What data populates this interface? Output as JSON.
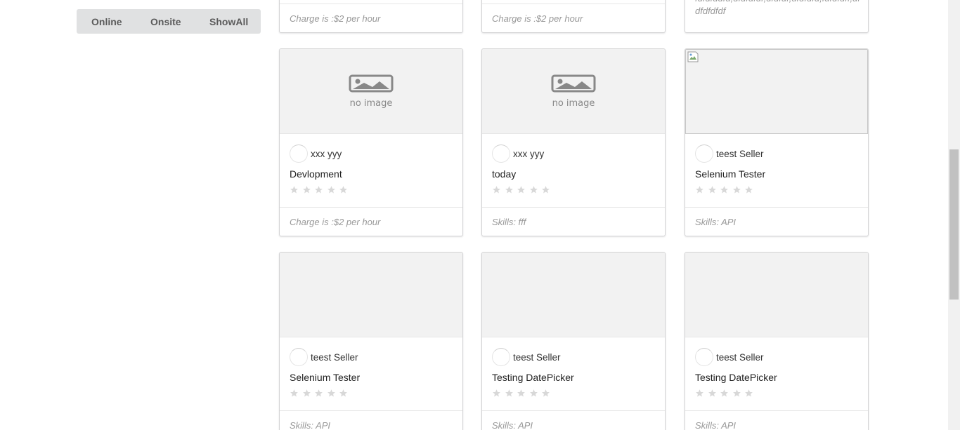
{
  "filter": {
    "online_label": "Online",
    "onsite_label": "Onsite",
    "showall_label": "ShowAll"
  },
  "top_cards": [
    {
      "footer": "Charge is :$2 per hour"
    },
    {
      "footer": "Charge is :$2 per hour"
    },
    {
      "footer": "fdfdfddfd,dfdfdfdf,dfdfdf,dfdfdfd,fdfdfdff,dfdfdfdfdf"
    }
  ],
  "cards": [
    {
      "image": "no-image",
      "seller": "xxx yyy",
      "title": "Devlopment",
      "rating": 0,
      "footer": "Charge is :$2 per hour"
    },
    {
      "image": "no-image",
      "seller": "xxx yyy",
      "title": "today",
      "rating": 0,
      "footer": "Skills: fff"
    },
    {
      "image": "broken-image",
      "seller": "teest Seller",
      "title": "Selenium Tester",
      "rating": 0,
      "footer": "Skills: API"
    },
    {
      "image": "blank",
      "seller": "teest Seller",
      "title": "Selenium Tester",
      "rating": 0,
      "footer": "Skills: API"
    },
    {
      "image": "blank",
      "seller": "teest Seller",
      "title": "Testing DatePicker",
      "rating": 0,
      "footer": "Skills: API"
    },
    {
      "image": "blank",
      "seller": "teest Seller",
      "title": "Testing DatePicker",
      "rating": 0,
      "footer": "Skills: API"
    }
  ],
  "no_image_label": "no image",
  "colors": {
    "star_empty": "#d8d8d8",
    "muted_text": "#999999"
  }
}
